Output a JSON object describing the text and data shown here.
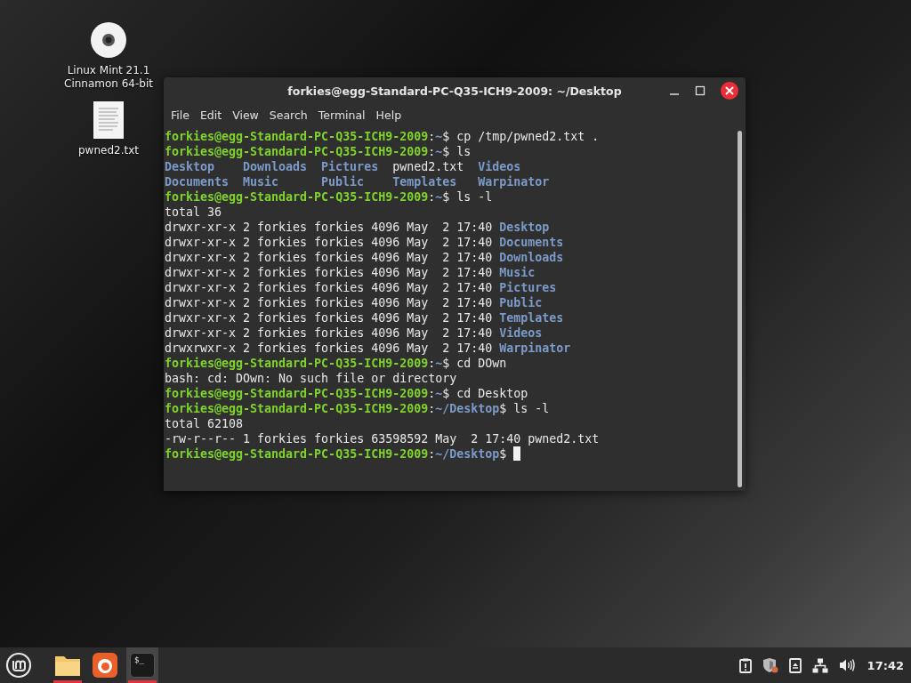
{
  "desktop_icons": [
    {
      "kind": "disc",
      "label": "Linux Mint 21.1\nCinnamon 64-bit"
    },
    {
      "kind": "document",
      "label": "pwned2.txt"
    }
  ],
  "window": {
    "title": "forkies@egg-Standard-PC-Q35-ICH9-2009: ~/Desktop",
    "menu": [
      "File",
      "Edit",
      "View",
      "Search",
      "Terminal",
      "Help"
    ],
    "lines": [
      {
        "kind": "text",
        "segments": [
          {
            "kind": "host",
            "text": "forkies@egg-Standard-PC-Q35-ICH9-2009"
          },
          {
            "kind": "plain",
            "text": ":"
          },
          {
            "kind": "path",
            "text": "~"
          },
          {
            "kind": "plain",
            "text": "$ cp /tmp/pwned2.txt ."
          }
        ]
      },
      {
        "kind": "text",
        "segments": [
          {
            "kind": "host",
            "text": "forkies@egg-Standard-PC-Q35-ICH9-2009"
          },
          {
            "kind": "plain",
            "text": ":"
          },
          {
            "kind": "path",
            "text": "~"
          },
          {
            "kind": "plain",
            "text": "$ ls"
          }
        ]
      },
      {
        "kind": "columns",
        "segments": [
          {
            "kind": "dir",
            "text": "Desktop"
          },
          {
            "kind": "dir",
            "text": "Downloads"
          },
          {
            "kind": "dir",
            "text": "Pictures"
          },
          {
            "kind": "plain",
            "text": "pwned2.txt"
          },
          {
            "kind": "dir",
            "text": "Videos"
          }
        ]
      },
      {
        "kind": "columns",
        "segments": [
          {
            "kind": "dir",
            "text": "Documents"
          },
          {
            "kind": "dir",
            "text": "Music"
          },
          {
            "kind": "dir",
            "text": "Public"
          },
          {
            "kind": "dir",
            "text": "Templates"
          },
          {
            "kind": "dir",
            "text": "Warpinator"
          }
        ]
      },
      {
        "kind": "text",
        "segments": [
          {
            "kind": "host",
            "text": "forkies@egg-Standard-PC-Q35-ICH9-2009"
          },
          {
            "kind": "plain",
            "text": ":"
          },
          {
            "kind": "path",
            "text": "~"
          },
          {
            "kind": "plain",
            "text": "$ ls -l"
          }
        ]
      },
      {
        "kind": "text",
        "segments": [
          {
            "kind": "plain",
            "text": "total 36"
          }
        ]
      },
      {
        "kind": "text",
        "segments": [
          {
            "kind": "plain",
            "text": "drwxr-xr-x 2 forkies forkies 4096 May  2 17:40 "
          },
          {
            "kind": "dir",
            "text": "Desktop"
          }
        ]
      },
      {
        "kind": "text",
        "segments": [
          {
            "kind": "plain",
            "text": "drwxr-xr-x 2 forkies forkies 4096 May  2 17:40 "
          },
          {
            "kind": "dir",
            "text": "Documents"
          }
        ]
      },
      {
        "kind": "text",
        "segments": [
          {
            "kind": "plain",
            "text": "drwxr-xr-x 2 forkies forkies 4096 May  2 17:40 "
          },
          {
            "kind": "dir",
            "text": "Downloads"
          }
        ]
      },
      {
        "kind": "text",
        "segments": [
          {
            "kind": "plain",
            "text": "drwxr-xr-x 2 forkies forkies 4096 May  2 17:40 "
          },
          {
            "kind": "dir",
            "text": "Music"
          }
        ]
      },
      {
        "kind": "text",
        "segments": [
          {
            "kind": "plain",
            "text": "drwxr-xr-x 2 forkies forkies 4096 May  2 17:40 "
          },
          {
            "kind": "dir",
            "text": "Pictures"
          }
        ]
      },
      {
        "kind": "text",
        "segments": [
          {
            "kind": "plain",
            "text": "drwxr-xr-x 2 forkies forkies 4096 May  2 17:40 "
          },
          {
            "kind": "dir",
            "text": "Public"
          }
        ]
      },
      {
        "kind": "text",
        "segments": [
          {
            "kind": "plain",
            "text": "drwxr-xr-x 2 forkies forkies 4096 May  2 17:40 "
          },
          {
            "kind": "dir",
            "text": "Templates"
          }
        ]
      },
      {
        "kind": "text",
        "segments": [
          {
            "kind": "plain",
            "text": "drwxr-xr-x 2 forkies forkies 4096 May  2 17:40 "
          },
          {
            "kind": "dir",
            "text": "Videos"
          }
        ]
      },
      {
        "kind": "text",
        "segments": [
          {
            "kind": "plain",
            "text": "drwxrwxr-x 2 forkies forkies 4096 May  2 17:40 "
          },
          {
            "kind": "dir",
            "text": "Warpinator"
          }
        ]
      },
      {
        "kind": "text",
        "segments": [
          {
            "kind": "host",
            "text": "forkies@egg-Standard-PC-Q35-ICH9-2009"
          },
          {
            "kind": "plain",
            "text": ":"
          },
          {
            "kind": "path",
            "text": "~"
          },
          {
            "kind": "plain",
            "text": "$ cd DOwn"
          }
        ]
      },
      {
        "kind": "text",
        "segments": [
          {
            "kind": "plain",
            "text": "bash: cd: DOwn: No such file or directory"
          }
        ]
      },
      {
        "kind": "text",
        "segments": [
          {
            "kind": "host",
            "text": "forkies@egg-Standard-PC-Q35-ICH9-2009"
          },
          {
            "kind": "plain",
            "text": ":"
          },
          {
            "kind": "path",
            "text": "~"
          },
          {
            "kind": "plain",
            "text": "$ cd Desktop"
          }
        ]
      },
      {
        "kind": "text",
        "segments": [
          {
            "kind": "host",
            "text": "forkies@egg-Standard-PC-Q35-ICH9-2009"
          },
          {
            "kind": "plain",
            "text": ":"
          },
          {
            "kind": "path",
            "text": "~/Desktop"
          },
          {
            "kind": "plain",
            "text": "$ ls -l"
          }
        ]
      },
      {
        "kind": "text",
        "segments": [
          {
            "kind": "plain",
            "text": "total 62108"
          }
        ]
      },
      {
        "kind": "text",
        "segments": [
          {
            "kind": "plain",
            "text": "-rw-r--r-- 1 forkies forkies 63598592 May  2 17:40 pwned2.txt"
          }
        ]
      },
      {
        "kind": "text",
        "segments": [
          {
            "kind": "host",
            "text": "forkies@egg-Standard-PC-Q35-ICH9-2009"
          },
          {
            "kind": "plain",
            "text": ":"
          },
          {
            "kind": "path",
            "text": "~/Desktop"
          },
          {
            "kind": "plain",
            "text": "$"
          }
        ]
      }
    ]
  },
  "taskbar": {
    "apps": [
      {
        "kind": "files",
        "running": true,
        "selected": false
      },
      {
        "kind": "browser",
        "running": false,
        "selected": false
      },
      {
        "kind": "terminal",
        "label": "$_",
        "running": true,
        "selected": true
      }
    ],
    "tray": [
      {
        "kind": "clipboard"
      },
      {
        "kind": "shield"
      },
      {
        "kind": "drive"
      },
      {
        "kind": "network"
      },
      {
        "kind": "volume"
      }
    ],
    "clock": "17:42"
  }
}
